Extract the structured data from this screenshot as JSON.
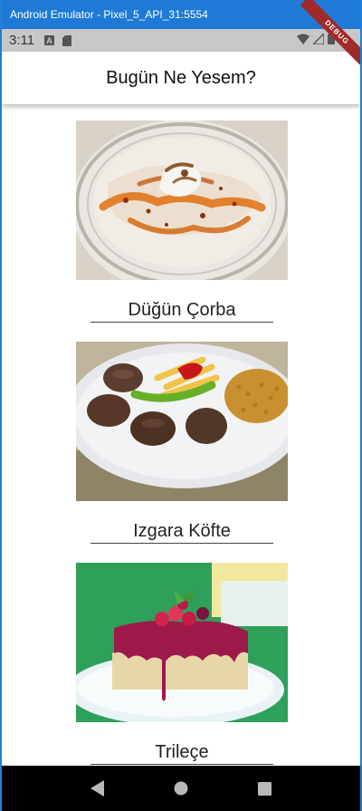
{
  "window": {
    "title": "Android Emulator - Pixel_5_API_31:5554"
  },
  "status_bar": {
    "time": "3:11",
    "icons": [
      "a-icon",
      "sd-card-icon",
      "wifi-icon",
      "signal-icon",
      "battery-icon"
    ]
  },
  "debug_banner": "DEBUG",
  "app_bar": {
    "title": "Bugün Ne Yesem?"
  },
  "foods": [
    {
      "name": "Düğün Çorba"
    },
    {
      "name": "Izgara Köfte"
    },
    {
      "name": "Trileçe"
    }
  ],
  "nav_bar": {
    "icons": [
      "back-icon",
      "home-icon",
      "recents-icon"
    ]
  }
}
